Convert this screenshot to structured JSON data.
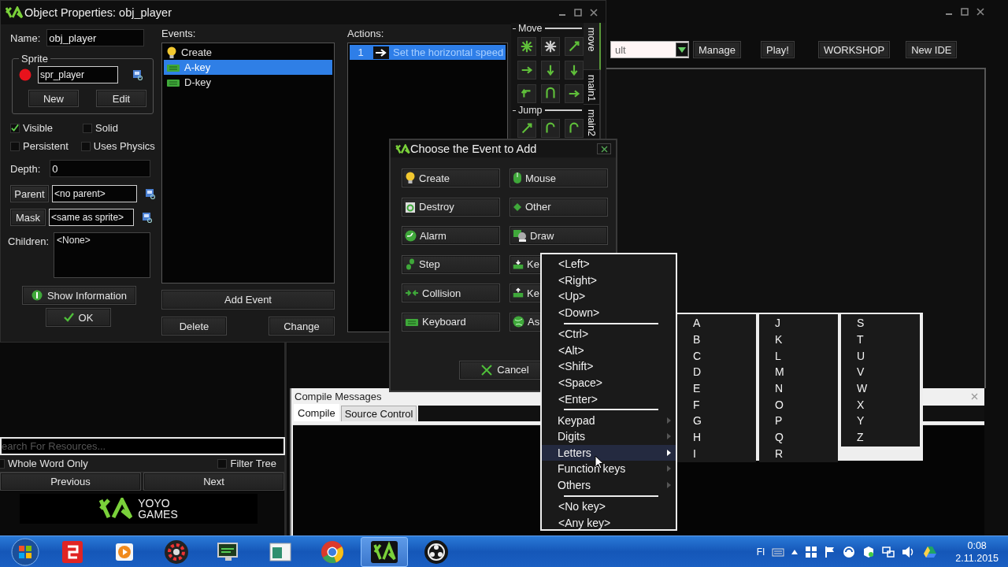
{
  "ide": {
    "toolbar": {
      "config_value": "ult",
      "buttons": [
        "Manage",
        "Play!",
        "WORKSHOP",
        "New IDE"
      ]
    },
    "compile_panel": {
      "title": "Compile Messages",
      "tabs": [
        {
          "label": "Compile",
          "selected": true
        },
        {
          "label": "Source Control",
          "selected": false
        }
      ]
    }
  },
  "resource_panel": {
    "search": {
      "placeholder": "earch For Resources..."
    },
    "options": [
      {
        "label": "Whole Word Only",
        "checked": false
      },
      {
        "label": "Filter Tree",
        "checked": false
      }
    ],
    "buttons": [
      "Previous",
      "Next"
    ],
    "logo": {
      "line_1": "YOYO",
      "line_2": "GAMES"
    }
  },
  "object_window": {
    "title": "Object Properties: obj_player",
    "name_label": "Name:",
    "name_value": "obj_player",
    "sprite_group": "Sprite",
    "sprite_value": "spr_player",
    "sprite_buttons": [
      "New",
      "Edit"
    ],
    "checkboxes": [
      {
        "label": "Visible",
        "checked": true
      },
      {
        "label": "Solid",
        "checked": false
      },
      {
        "label": "Persistent",
        "checked": false
      },
      {
        "label": "Uses Physics",
        "checked": false
      }
    ],
    "depth_label": "Depth:",
    "depth_value": "0",
    "parent_button": "Parent",
    "parent_value": "<no parent>",
    "mask_button": "Mask",
    "mask_value": "<same as sprite>",
    "children_label": "Children:",
    "children_value": "<None>",
    "show_info_button": "Show Information",
    "ok_button": "OK",
    "events_label": "Events:",
    "events": [
      {
        "label": "Create",
        "kind": "create",
        "selected": false
      },
      {
        "label": "A-key",
        "kind": "keyboard",
        "selected": true
      },
      {
        "label": "D-key",
        "kind": "keyboard",
        "selected": false
      }
    ],
    "add_event_button": "Add Event",
    "delete_button": "Delete",
    "change_button": "Change",
    "actions_label": "Actions:",
    "actions": [
      {
        "number": "1",
        "label": "Set the horizontal speed",
        "selected": true
      }
    ],
    "library_groups": [
      {
        "title": "Move",
        "kind": "move"
      },
      {
        "title": "Jump",
        "kind": "jump"
      }
    ],
    "library_tabs": [
      {
        "label": "move",
        "selected": true
      },
      {
        "label": "main1",
        "selected": false
      },
      {
        "label": "main2",
        "selected": false
      }
    ]
  },
  "event_dialog": {
    "title": "Choose the Event to Add",
    "buttons": [
      {
        "label": "Create",
        "kind": "create"
      },
      {
        "label": "Mouse",
        "kind": "mouse"
      },
      {
        "label": "Destroy",
        "kind": "destroy"
      },
      {
        "label": "Other",
        "kind": "other"
      },
      {
        "label": "Alarm",
        "kind": "alarm"
      },
      {
        "label": "Draw",
        "kind": "draw"
      },
      {
        "label": "Step",
        "kind": "step"
      },
      {
        "label": "Ke",
        "kind": "key_press"
      },
      {
        "label": "Collision",
        "kind": "collision"
      },
      {
        "label": "Ke",
        "kind": "key_release"
      },
      {
        "label": "Keyboard",
        "kind": "keyboard"
      },
      {
        "label": "As",
        "kind": "async"
      }
    ],
    "cancel_button": "Cancel"
  },
  "key_menu": {
    "items": [
      {
        "kind": "item",
        "label": "<Left>",
        "selected": false
      },
      {
        "kind": "item",
        "label": "<Right>",
        "selected": false
      },
      {
        "kind": "item",
        "label": "<Up>",
        "selected": false
      },
      {
        "kind": "item",
        "label": "<Down>",
        "selected": false
      },
      {
        "kind": "separator"
      },
      {
        "kind": "item",
        "label": "<Ctrl>",
        "selected": false
      },
      {
        "kind": "item",
        "label": "<Alt>",
        "selected": false
      },
      {
        "kind": "item",
        "label": "<Shift>",
        "selected": false
      },
      {
        "kind": "item",
        "label": "<Space>",
        "selected": false
      },
      {
        "kind": "item",
        "label": "<Enter>",
        "selected": false
      },
      {
        "kind": "separator"
      },
      {
        "kind": "submenu",
        "label": "Keypad",
        "selected": false
      },
      {
        "kind": "submenu",
        "label": "Digits",
        "selected": false
      },
      {
        "kind": "submenu",
        "label": "Letters",
        "selected": true
      },
      {
        "kind": "submenu",
        "label": "Function keys",
        "selected": false
      },
      {
        "kind": "submenu",
        "label": "Others",
        "selected": false
      },
      {
        "kind": "separator"
      },
      {
        "kind": "item",
        "label": "<No key>",
        "selected": false
      },
      {
        "kind": "item",
        "label": "<Any key>",
        "selected": false
      }
    ],
    "letter_columns": [
      [
        "A",
        "B",
        "C",
        "D",
        "E",
        "F",
        "G",
        "H",
        "I"
      ],
      [
        "J",
        "K",
        "L",
        "M",
        "N",
        "O",
        "P",
        "Q",
        "R"
      ],
      [
        "S",
        "T",
        "U",
        "V",
        "W",
        "X",
        "Y",
        "Z"
      ]
    ]
  },
  "taskbar": {
    "apps": [
      {
        "kind": "slides",
        "selected": false
      },
      {
        "kind": "media",
        "selected": false
      },
      {
        "kind": "gear",
        "selected": false
      },
      {
        "kind": "monitor",
        "selected": false
      },
      {
        "kind": "window",
        "selected": false
      },
      {
        "kind": "browser",
        "selected": false
      },
      {
        "kind": "gamemaker",
        "selected": true
      },
      {
        "kind": "recorder",
        "selected": false
      }
    ],
    "language": "FI",
    "time": "0:08",
    "date": "2.11.2015"
  }
}
